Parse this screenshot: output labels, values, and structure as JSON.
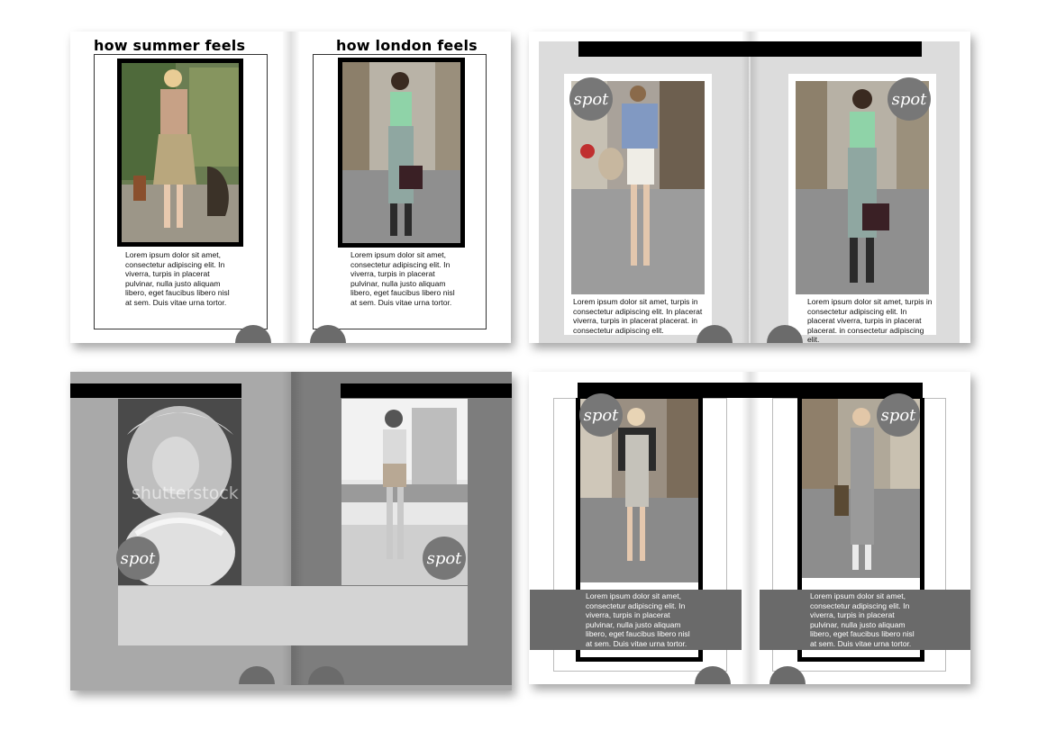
{
  "spread_1": {
    "left_heading": "how summer feels",
    "right_heading": "how london feels",
    "left_body": "Lorem ipsum dolor sit amet, consectetur adipiscing elit. In viverra, turpis in placerat pulvinar, nulla justo aliquam libero, eget faucibus libero nisl at sem. Duis vitae urna tortor.",
    "right_body": "Lorem ipsum dolor sit amet, consectetur adipiscing elit. In viverra, turpis in placerat pulvinar, nulla justo aliquam libero, eget faucibus libero nisl at sem. Duis vitae urna tortor."
  },
  "spread_2": {
    "spot_label": "spot",
    "left_body": "Lorem ipsum dolor sit amet, turpis in consectetur adipiscing elit. In placerat viverra, turpis in placerat placerat. in consectetur adipiscing elit.",
    "right_body": "Lorem ipsum dolor sit amet, turpis in consectetur adipiscing elit. In placerat viverra, turpis in placerat placerat. in consectetur adipiscing elit."
  },
  "spread_3": {
    "spot_label": "spot",
    "watermark": "shutterstock"
  },
  "spread_4": {
    "spot_label": "spot",
    "left_body": "Lorem ipsum dolor sit amet, consectetur adipiscing elit. In viverra, turpis in placerat pulvinar, nulla justo aliquam libero, eget faucibus libero nisl at sem. Duis vitae urna tortor.",
    "right_body": "Lorem ipsum dolor sit amet, consectetur adipiscing elit. In viverra, turpis in placerat pulvinar, nulla justo aliquam libero, eget faucibus libero nisl at sem. Duis vitae urna tortor."
  },
  "colors": {
    "spot_circle": "#777777",
    "folio_circle": "#6b6b6b",
    "page_gray_light": "#dcdcdc",
    "page_gray_mid": "#a9a9a9",
    "page_gray_dark": "#7d7d7d",
    "text_band": "#6a6a6a"
  }
}
